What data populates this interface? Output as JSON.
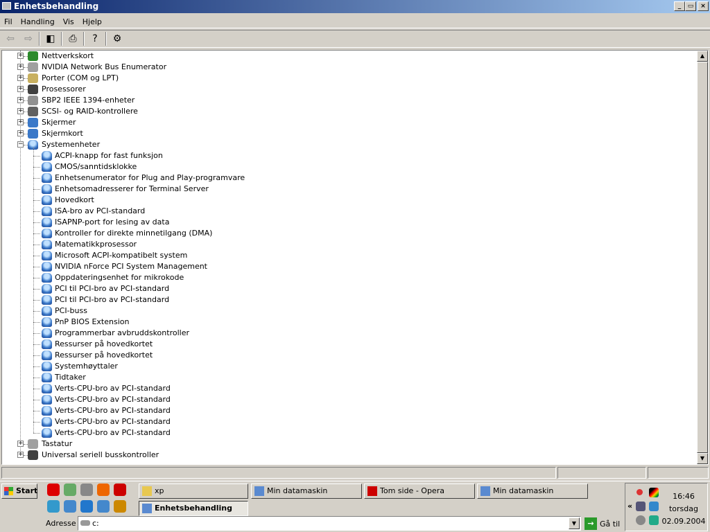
{
  "window": {
    "title": "Enhetsbehandling",
    "buttons": [
      "_",
      "▭",
      "×"
    ]
  },
  "menu": [
    "Fil",
    "Handling",
    "Vis",
    "Hjelp"
  ],
  "toolbar": [
    {
      "name": "back-icon",
      "glyph": "⇦",
      "disabled": true
    },
    {
      "name": "forward-icon",
      "glyph": "⇨",
      "disabled": true
    },
    {
      "name": "show-hide-tree-icon",
      "glyph": "◧"
    },
    {
      "name": "print-icon",
      "glyph": "⎙"
    },
    {
      "name": "help-icon",
      "glyph": "?"
    },
    {
      "name": "properties-icon",
      "glyph": "⚙"
    }
  ],
  "tree": {
    "top_before": [
      {
        "label": "Nettverkskort",
        "icon": "network-card-icon",
        "color": "#2c8a2c"
      },
      {
        "label": "NVIDIA Network Bus Enumerator",
        "icon": "diamond-icon",
        "color": "#a0a0a0"
      },
      {
        "label": "Porter (COM og LPT)",
        "icon": "port-icon",
        "color": "#c8b060"
      },
      {
        "label": "Prosessorer",
        "icon": "processor-icon",
        "color": "#404040"
      },
      {
        "label": "SBP2 IEEE 1394-enheter",
        "icon": "ieee1394-icon",
        "color": "#909090"
      },
      {
        "label": "SCSI- og RAID-kontrollere",
        "icon": "scsi-icon",
        "color": "#606060"
      },
      {
        "label": "Skjermer",
        "icon": "monitor-icon",
        "color": "#3a78c8"
      },
      {
        "label": "Skjermkort",
        "icon": "display-adapter-icon",
        "color": "#3a78c8"
      }
    ],
    "expanded": {
      "label": "Systemenheter",
      "children": [
        "ACPI-knapp for fast funksjon",
        "CMOS/sanntidsklokke",
        "Enhetsenumerator for Plug and Play-programvare",
        "Enhetsomadresserer for Terminal Server",
        "Hovedkort",
        "ISA-bro av PCI-standard",
        "ISAPNP-port for lesing av data",
        "Kontroller for direkte minnetilgang (DMA)",
        "Matematikkprosessor",
        "Microsoft ACPI-kompatibelt system",
        "NVIDIA nForce PCI System Management",
        "Oppdateringsenhet for mikrokode",
        "PCI til PCI-bro av PCI-standard",
        "PCI til PCI-bro av PCI-standard",
        "PCI-buss",
        "PnP BIOS Extension",
        "Programmerbar avbruddskontroller",
        "Ressurser på hovedkortet",
        "Ressurser på hovedkortet",
        "Systemhøyttaler",
        "Tidtaker",
        "Verts-CPU-bro av PCI-standard",
        "Verts-CPU-bro av PCI-standard",
        "Verts-CPU-bro av PCI-standard",
        "Verts-CPU-bro av PCI-standard",
        "Verts-CPU-bro av PCI-standard"
      ]
    },
    "top_after": [
      {
        "label": "Tastatur",
        "icon": "keyboard-icon",
        "color": "#a0a0a0"
      },
      {
        "label": "Universal seriell busskontroller",
        "icon": "usb-icon",
        "color": "#404040"
      }
    ]
  },
  "taskbar": {
    "start": "Start",
    "quicklaunch": [
      [
        "dc-icon",
        "#d00"
      ],
      [
        "music-icon",
        "#6a6"
      ],
      [
        "calendar-icon",
        "#888"
      ],
      [
        "firefox-icon",
        "#e60"
      ],
      [
        "opera-icon",
        "#c00"
      ],
      [
        "quicktime-icon",
        "#39c"
      ],
      [
        "notepad-icon",
        "#48c"
      ],
      [
        "ie-icon",
        "#27c"
      ],
      [
        "outlook-icon",
        "#48c"
      ],
      [
        "tool-icon",
        "#c80"
      ]
    ],
    "tasks": [
      {
        "label": "xp",
        "icon": "folder-icon"
      },
      {
        "label": "Min datamaskin",
        "icon": "computer-icon"
      },
      {
        "label": "Tom side - Opera",
        "icon": "opera-icon"
      },
      {
        "label": "Min datamaskin",
        "icon": "computer-icon"
      },
      {
        "label": "Enhetsbehandling",
        "icon": "device-manager-icon",
        "active": true
      }
    ],
    "address": {
      "label": "Adresse",
      "value": "c:",
      "go": "Gå til"
    },
    "clock": {
      "time": "16:46",
      "day": "torsdag",
      "date": "02.09.2004"
    },
    "tray_expand": "«"
  }
}
